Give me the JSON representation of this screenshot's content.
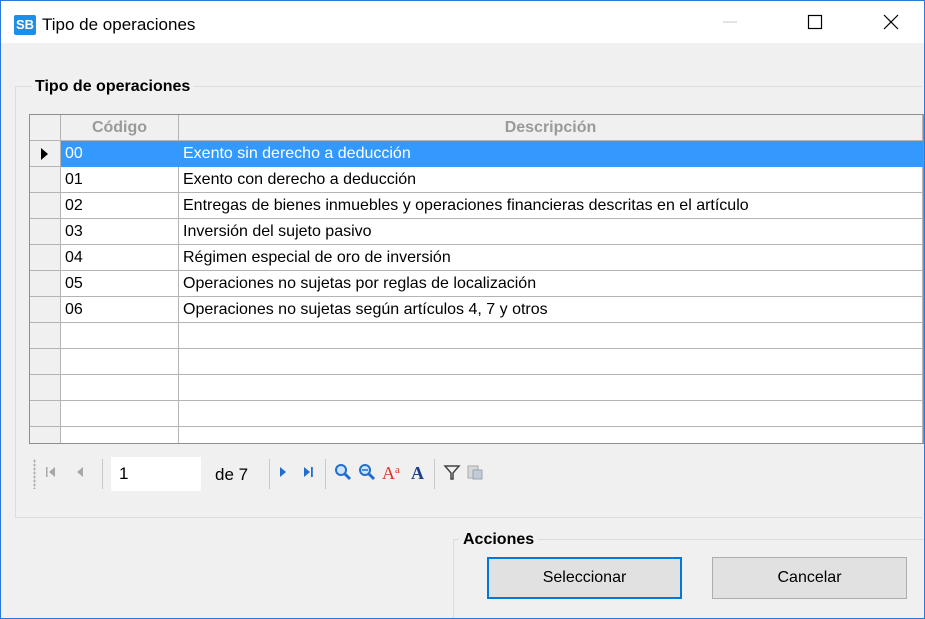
{
  "window": {
    "app_icon_text": "SB",
    "title": "Tipo de operaciones"
  },
  "group": {
    "title": "Tipo de operaciones"
  },
  "grid": {
    "columns": {
      "code": "Código",
      "description": "Descripción"
    },
    "selected_index": 0,
    "rows": [
      {
        "code": "00",
        "description": "Exento sin derecho a deducción"
      },
      {
        "code": "01",
        "description": "Exento con derecho a deducción"
      },
      {
        "code": "02",
        "description": "Entregas de bienes inmuebles y operaciones financieras descritas en el artículo"
      },
      {
        "code": "03",
        "description": "Inversión del sujeto pasivo"
      },
      {
        "code": "04",
        "description": "Régimen especial de oro de inversión"
      },
      {
        "code": "05",
        "description": "Operaciones no sujetas por reglas de localización"
      },
      {
        "code": "06",
        "description": "Operaciones no sujetas según artículos 4, 7 y otros"
      },
      {
        "code": "",
        "description": ""
      },
      {
        "code": "",
        "description": ""
      },
      {
        "code": "",
        "description": ""
      },
      {
        "code": "",
        "description": ""
      },
      {
        "code": "",
        "description": ""
      }
    ]
  },
  "pager": {
    "current_page": "1",
    "of_label": "de 7"
  },
  "actions": {
    "title": "Acciones",
    "select_label": "Seleccionar",
    "cancel_label": "Cancelar"
  },
  "colors": {
    "selection": "#3399ff",
    "accent": "#0078d7",
    "app_icon": "#1f8fe6"
  }
}
